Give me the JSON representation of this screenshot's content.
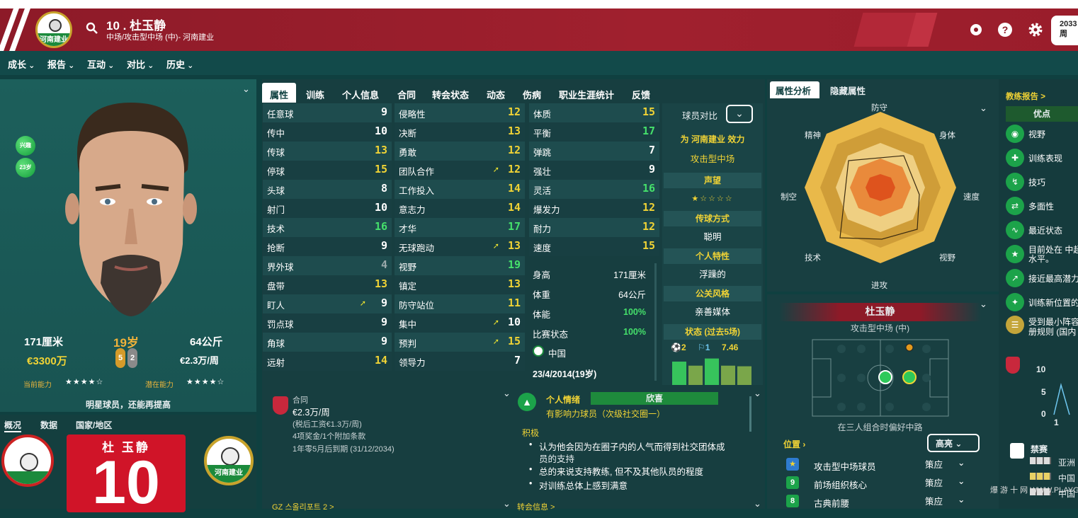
{
  "header": {
    "player_title": "10 . 杜玉静",
    "player_subtitle": "中场/攻击型中场 (中)- 河南建业",
    "club_logo_text": "河南建业",
    "date_line1": "2033",
    "date_line2": "周"
  },
  "nav": [
    "成长",
    "报告",
    "互动",
    "对比",
    "历史"
  ],
  "profile": {
    "badge1": "兴趣",
    "badge2": "23岁",
    "height": "171厘米",
    "age": "19岁",
    "weight": "64公斤",
    "value": "€3300万",
    "foot_left": "5",
    "foot_right": "2",
    "wage": "€2.3万/周",
    "current_ability_label": "当前能力",
    "potential_ability_label": "潜在能力",
    "current_stars": "★★★★☆",
    "potential_stars": "★★★★☆",
    "summary": "明星球员，还能再提高"
  },
  "lower_left": {
    "tabs": [
      "概况",
      "数据",
      "国家/地区"
    ],
    "shirt_name": "杜 玉静",
    "shirt_number": "10",
    "club_crest_text": "河南建业"
  },
  "tabs": [
    "属性",
    "训练",
    "个人信息",
    "合同",
    "转会状态",
    "动态",
    "伤病",
    "职业生涯统计",
    "反馈"
  ],
  "attributes": {
    "col1": [
      {
        "name": "任意球",
        "value": "9",
        "tone": "w"
      },
      {
        "name": "传中",
        "value": "10",
        "tone": "w"
      },
      {
        "name": "传球",
        "value": "13",
        "tone": "y"
      },
      {
        "name": "停球",
        "value": "15",
        "tone": "y"
      },
      {
        "name": "头球",
        "value": "8",
        "tone": "w"
      },
      {
        "name": "射门",
        "value": "10",
        "tone": "w"
      },
      {
        "name": "技术",
        "value": "16",
        "tone": "g"
      },
      {
        "name": "抢断",
        "value": "9",
        "tone": "w"
      },
      {
        "name": "界外球",
        "value": "4",
        "tone": "d"
      },
      {
        "name": "盘带",
        "value": "13",
        "tone": "y"
      },
      {
        "name": "盯人",
        "value": "9",
        "tone": "w",
        "arrow": true
      },
      {
        "name": "罚点球",
        "value": "9",
        "tone": "w"
      },
      {
        "name": "角球",
        "value": "9",
        "tone": "w"
      },
      {
        "name": "远射",
        "value": "14",
        "tone": "y"
      }
    ],
    "col2": [
      {
        "name": "侵略性",
        "value": "12",
        "tone": "y"
      },
      {
        "name": "决断",
        "value": "13",
        "tone": "y"
      },
      {
        "name": "勇敢",
        "value": "12",
        "tone": "y"
      },
      {
        "name": "团队合作",
        "value": "12",
        "tone": "y",
        "arrow": true
      },
      {
        "name": "工作投入",
        "value": "14",
        "tone": "y"
      },
      {
        "name": "意志力",
        "value": "14",
        "tone": "y"
      },
      {
        "name": "才华",
        "value": "17",
        "tone": "g"
      },
      {
        "name": "无球跑动",
        "value": "13",
        "tone": "y",
        "arrow": true
      },
      {
        "name": "视野",
        "value": "19",
        "tone": "g"
      },
      {
        "name": "镇定",
        "value": "13",
        "tone": "y"
      },
      {
        "name": "防守站位",
        "value": "11",
        "tone": "y"
      },
      {
        "name": "集中",
        "value": "10",
        "tone": "w",
        "arrow": true
      },
      {
        "name": "预判",
        "value": "15",
        "tone": "y",
        "arrow": true
      },
      {
        "name": "领导力",
        "value": "7",
        "tone": "w"
      }
    ],
    "col3": [
      {
        "name": "体质",
        "value": "15",
        "tone": "y"
      },
      {
        "name": "平衡",
        "value": "17",
        "tone": "g"
      },
      {
        "name": "弹跳",
        "value": "7",
        "tone": "w"
      },
      {
        "name": "强壮",
        "value": "9",
        "tone": "w"
      },
      {
        "name": "灵活",
        "value": "16",
        "tone": "g"
      },
      {
        "name": "爆发力",
        "value": "12",
        "tone": "y"
      },
      {
        "name": "耐力",
        "value": "12",
        "tone": "y"
      },
      {
        "name": "速度",
        "value": "15",
        "tone": "y"
      }
    ]
  },
  "info": {
    "height_label": "身高",
    "height": "171厘米",
    "weight_label": "体重",
    "weight": "64公斤",
    "fitness_label": "体能",
    "fitness": "100%",
    "match_label": "比赛状态",
    "match": "100%",
    "nation": "中国",
    "dob": "23/4/2014(19岁)"
  },
  "compare": {
    "title": "球员对比",
    "plays_for": "为 河南建业 效力",
    "position": "攻击型中场",
    "reputation_label": "声望",
    "reputation_stars": "★☆☆☆☆",
    "passing_label": "传球方式",
    "passing": "聪明",
    "personality_label": "个人特性",
    "personality": "浮躁的",
    "media_label": "公关风格",
    "media": "亲善媒体",
    "form_label": "状态 (过去5场)",
    "form_goals": "2",
    "form_assists": "1",
    "form_rating": "7.46",
    "form_bars": [
      0.75,
      0.62,
      0.85,
      0.62,
      0.6
    ]
  },
  "contract": {
    "label": "合同",
    "wage": "€2.3万/周",
    "after_tax": "(税后工资€1.3万/周)",
    "bonus": "4项奖金/1个附加条款",
    "expiry": "1年零5月后到期 (31/12/2034)"
  },
  "mood": {
    "label": "个人情绪",
    "status": "欣喜",
    "influence": "有影响力球员（次级社交圈一）",
    "positive_label": "积极",
    "bullets": [
      "认为他会因为在圈子内的人气而得到社交团体成",
      "员的支持",
      "总的来说支持教练, 但不及其他队员的程度",
      "对训练总体上感到满意"
    ]
  },
  "bottom_tabs": {
    "left": "GZ 스올리포트 2 >",
    "right": "转会信息 >"
  },
  "radar": {
    "tab1": "属性分析",
    "tab2": "隐藏属性",
    "labels": [
      "防守",
      "身体",
      "速度",
      "视野",
      "进攻",
      "技术",
      "制空",
      "精神"
    ]
  },
  "pitch": {
    "name": "杜玉静",
    "role": "攻击型中场 (中)",
    "caption": "在三人组合时偏好中路",
    "positions_label": "位置",
    "highlight_label": "高亮",
    "roles": [
      {
        "name": "攻击型中场球员",
        "duty": "策应"
      },
      {
        "name": "前场组织核心",
        "duty": "策应"
      },
      {
        "name": "古典前腰",
        "duty": "策应"
      }
    ]
  },
  "right": {
    "report_label": "教练报告 >",
    "strengths_label": "优点",
    "items": [
      "视野",
      "训练表现",
      "技巧",
      "多面性",
      "最近状态",
      "目前处在 中超",
      "水平。",
      "接近最高潜力",
      "训练新位置的",
      "受到最小阵容",
      "册规则 (国内"
    ],
    "chart_ticks": [
      "10",
      "5",
      "0",
      "1"
    ],
    "ban_label": "禁赛",
    "ban_rows": [
      "亚洲",
      "中国",
      "中国"
    ]
  },
  "watermark": "爆 游 十 网 WWW.PLAYGM.CC"
}
